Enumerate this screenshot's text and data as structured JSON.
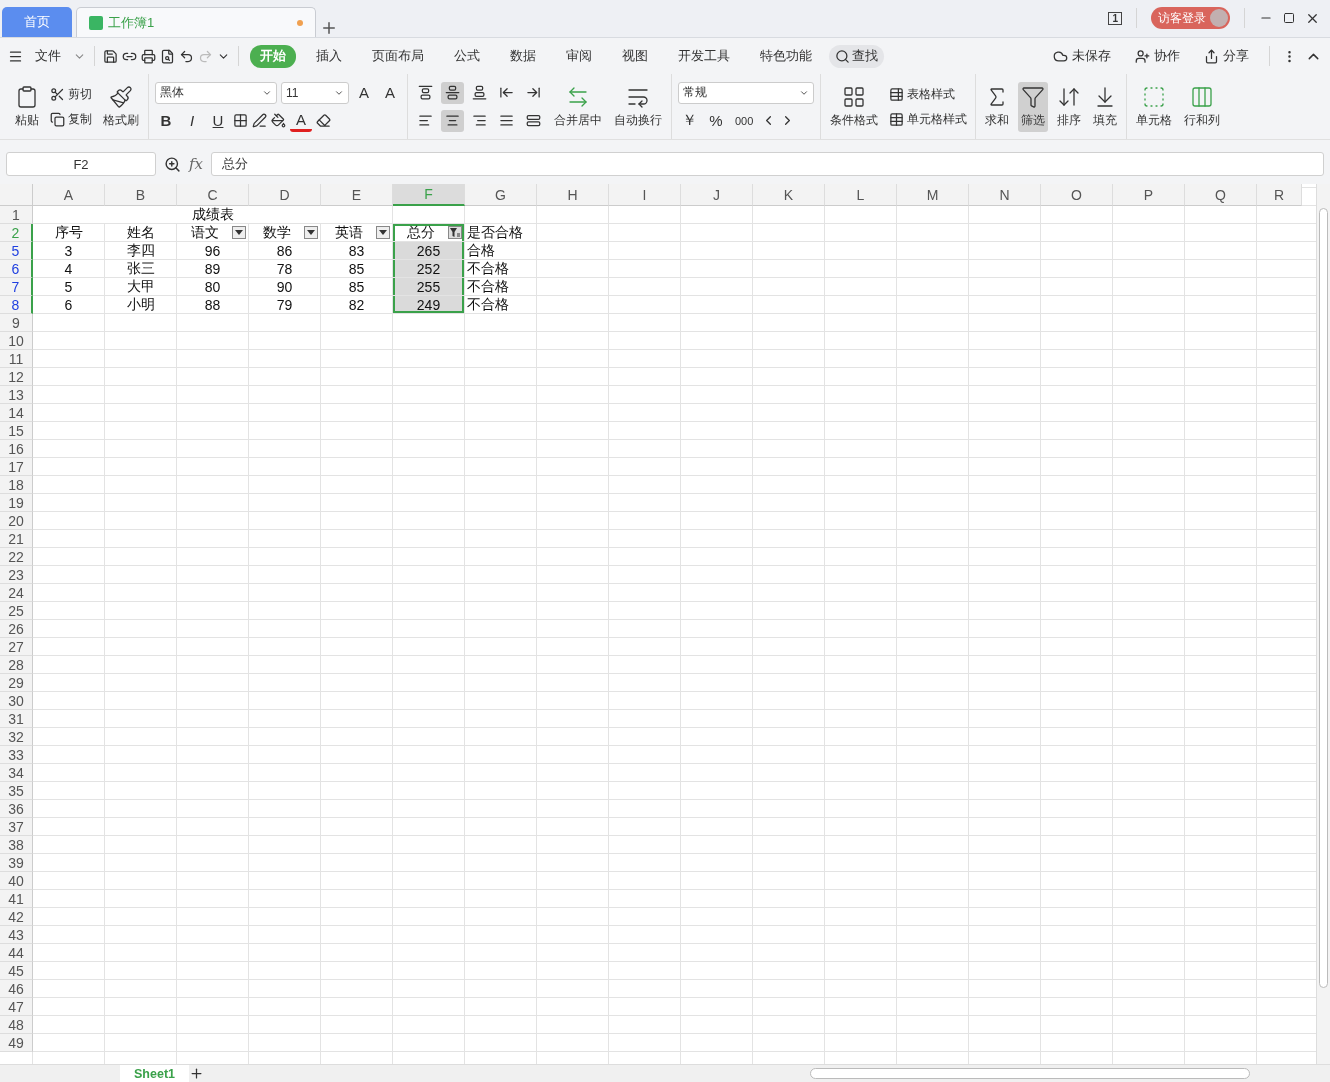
{
  "tabs": [
    {
      "label": "首页",
      "kind": "home",
      "selected": false
    },
    {
      "label": "工作簿1",
      "kind": "document",
      "selected": true
    }
  ],
  "window": {
    "window_count": "1",
    "login": "访客登录"
  },
  "menu": {
    "file": "文件",
    "ribbon_tabs": [
      {
        "label": "开始",
        "selected": true
      },
      {
        "label": "插入",
        "selected": false
      },
      {
        "label": "页面布局",
        "selected": false
      },
      {
        "label": "公式",
        "selected": false
      },
      {
        "label": "数据",
        "selected": false
      },
      {
        "label": "审阅",
        "selected": false
      },
      {
        "label": "视图",
        "selected": false
      },
      {
        "label": "开发工具",
        "selected": false
      },
      {
        "label": "特色功能",
        "selected": false
      }
    ],
    "search": "查找",
    "actions": [
      {
        "label": "未保存",
        "kind": "cloud"
      },
      {
        "label": "协作",
        "kind": "user"
      },
      {
        "label": "分享",
        "kind": "share"
      }
    ]
  },
  "ribbon": {
    "paste": "粘贴",
    "cut": "剪切",
    "copy": "复制",
    "format_painter": "格式刷",
    "font": "黑体",
    "font_size": "11",
    "grow": "A",
    "shrink": "A",
    "bold": "B",
    "italic": "I",
    "underline": "U",
    "font_color": "A",
    "vertical_align": [
      {
        "kind": "top",
        "selected": false
      },
      {
        "kind": "middle",
        "selected": true
      },
      {
        "kind": "bottom",
        "selected": false
      },
      {
        "kind": "outdent",
        "selected": false
      },
      {
        "kind": "indent",
        "selected": false
      }
    ],
    "horizontal_align": [
      {
        "kind": "left",
        "selected": false
      },
      {
        "kind": "center",
        "selected": true
      },
      {
        "kind": "right",
        "selected": false
      },
      {
        "kind": "justify",
        "selected": false
      },
      {
        "kind": "distributed",
        "selected": false
      }
    ],
    "merge": "合并居中",
    "wrap": "自动换行",
    "number_format": "常规",
    "currency": "￥",
    "percent": "%",
    "thousands": "000",
    "conditional": "条件格式",
    "table_style": "表格样式",
    "cell_style": "单元格样式",
    "tools": [
      {
        "label": "求和",
        "kind": "sum",
        "selected": false
      },
      {
        "label": "筛选",
        "kind": "filter",
        "selected": true
      },
      {
        "label": "排序",
        "kind": "sort",
        "selected": false
      },
      {
        "label": "填充",
        "kind": "fill",
        "selected": false
      },
      {
        "label": "单元格",
        "kind": "cell",
        "selected": false
      },
      {
        "label": "行和列",
        "kind": "rowcol",
        "selected": false
      }
    ]
  },
  "formula_bar": {
    "cell": "F2",
    "fx": "fx",
    "formula": "总分"
  },
  "sheet": {
    "columns": [
      {
        "label": "A",
        "selected": false
      },
      {
        "label": "B",
        "selected": false
      },
      {
        "label": "C",
        "selected": false
      },
      {
        "label": "D",
        "selected": false
      },
      {
        "label": "E",
        "selected": false
      },
      {
        "label": "F",
        "selected": true
      },
      {
        "label": "G",
        "selected": false
      },
      {
        "label": "H",
        "selected": false
      },
      {
        "label": "I",
        "selected": false
      },
      {
        "label": "J",
        "selected": false
      },
      {
        "label": "K",
        "selected": false
      },
      {
        "label": "L",
        "selected": false
      },
      {
        "label": "M",
        "selected": false
      },
      {
        "label": "N",
        "selected": false
      },
      {
        "label": "O",
        "selected": false
      },
      {
        "label": "P",
        "selected": false
      },
      {
        "label": "Q",
        "selected": false
      },
      {
        "label": "R",
        "selected": false
      }
    ],
    "rows": [
      {
        "number": "1",
        "filtered": false,
        "selected": false,
        "cells": [
          {
            "text": "成绩表",
            "merged": true
          }
        ]
      },
      {
        "number": "2",
        "filtered": false,
        "selected": true,
        "cells": [
          {
            "text": "序号"
          },
          {
            "text": "姓名"
          },
          {
            "text": "语文",
            "filter_button": true,
            "filter_active": false
          },
          {
            "text": "数学",
            "filter_button": true,
            "filter_active": false
          },
          {
            "text": "英语",
            "filter_button": true,
            "filter_active": false
          },
          {
            "text": "总分",
            "filter_button": true,
            "filter_active": true,
            "selected": true,
            "active": true
          },
          {
            "text": "是否合格"
          }
        ]
      },
      {
        "number": "5",
        "filtered": true,
        "selected": true,
        "cells": [
          {
            "text": "3"
          },
          {
            "text": "李四"
          },
          {
            "text": "96"
          },
          {
            "text": "86"
          },
          {
            "text": "83"
          },
          {
            "text": "265",
            "selected": true
          },
          {
            "text": "合格"
          }
        ]
      },
      {
        "number": "6",
        "filtered": true,
        "selected": true,
        "cells": [
          {
            "text": "4"
          },
          {
            "text": "张三"
          },
          {
            "text": "89"
          },
          {
            "text": "78"
          },
          {
            "text": "85"
          },
          {
            "text": "252",
            "selected": true
          },
          {
            "text": "不合格"
          }
        ]
      },
      {
        "number": "7",
        "filtered": true,
        "selected": true,
        "cells": [
          {
            "text": "5"
          },
          {
            "text": "大甲"
          },
          {
            "text": "80"
          },
          {
            "text": "90"
          },
          {
            "text": "85"
          },
          {
            "text": "255",
            "selected": true
          },
          {
            "text": "不合格"
          }
        ]
      },
      {
        "number": "8",
        "filtered": true,
        "selected": true,
        "cells": [
          {
            "text": "6"
          },
          {
            "text": "小明"
          },
          {
            "text": "88"
          },
          {
            "text": "79"
          },
          {
            "text": "82"
          },
          {
            "text": "249",
            "selected": true
          },
          {
            "text": "不合格"
          }
        ]
      },
      {
        "number": "9",
        "filtered": false,
        "selected": false
      },
      {
        "number": "10",
        "filtered": false,
        "selected": false
      },
      {
        "number": "11",
        "filtered": false,
        "selected": false
      },
      {
        "number": "12",
        "filtered": false,
        "selected": false
      },
      {
        "number": "13",
        "filtered": false,
        "selected": false
      },
      {
        "number": "14",
        "filtered": false,
        "selected": false
      },
      {
        "number": "15",
        "filtered": false,
        "selected": false
      },
      {
        "number": "16",
        "filtered": false,
        "selected": false
      },
      {
        "number": "17",
        "filtered": false,
        "selected": false
      },
      {
        "number": "18",
        "filtered": false,
        "selected": false
      },
      {
        "number": "19",
        "filtered": false,
        "selected": false
      },
      {
        "number": "20",
        "filtered": false,
        "selected": false
      },
      {
        "number": "21",
        "filtered": false,
        "selected": false
      },
      {
        "number": "22",
        "filtered": false,
        "selected": false
      },
      {
        "number": "23",
        "filtered": false,
        "selected": false
      },
      {
        "number": "24",
        "filtered": false,
        "selected": false
      },
      {
        "number": "25",
        "filtered": false,
        "selected": false
      },
      {
        "number": "26",
        "filtered": false,
        "selected": false
      },
      {
        "number": "27",
        "filtered": false,
        "selected": false
      },
      {
        "number": "28",
        "filtered": false,
        "selected": false
      },
      {
        "number": "29",
        "filtered": false,
        "selected": false
      },
      {
        "number": "30",
        "filtered": false,
        "selected": false
      },
      {
        "number": "31",
        "filtered": false,
        "selected": false
      },
      {
        "number": "32",
        "filtered": false,
        "selected": false
      },
      {
        "number": "33",
        "filtered": false,
        "selected": false
      },
      {
        "number": "34",
        "filtered": false,
        "selected": false
      },
      {
        "number": "35",
        "filtered": false,
        "selected": false
      },
      {
        "number": "36",
        "filtered": false,
        "selected": false
      },
      {
        "number": "37",
        "filtered": false,
        "selected": false
      },
      {
        "number": "38",
        "filtered": false,
        "selected": false
      },
      {
        "number": "39",
        "filtered": false,
        "selected": false
      },
      {
        "number": "40",
        "filtered": false,
        "selected": false
      },
      {
        "number": "41",
        "filtered": false,
        "selected": false
      },
      {
        "number": "42",
        "filtered": false,
        "selected": false
      },
      {
        "number": "43",
        "filtered": false,
        "selected": false
      },
      {
        "number": "44",
        "filtered": false,
        "selected": false
      },
      {
        "number": "45",
        "filtered": false,
        "selected": false
      },
      {
        "number": "46",
        "filtered": false,
        "selected": false
      },
      {
        "number": "47",
        "filtered": false,
        "selected": false
      },
      {
        "number": "48",
        "filtered": false,
        "selected": false
      },
      {
        "number": "49",
        "filtered": false,
        "selected": false
      }
    ]
  },
  "sheet_tabs": [
    {
      "label": "Sheet1",
      "selected": true
    }
  ]
}
